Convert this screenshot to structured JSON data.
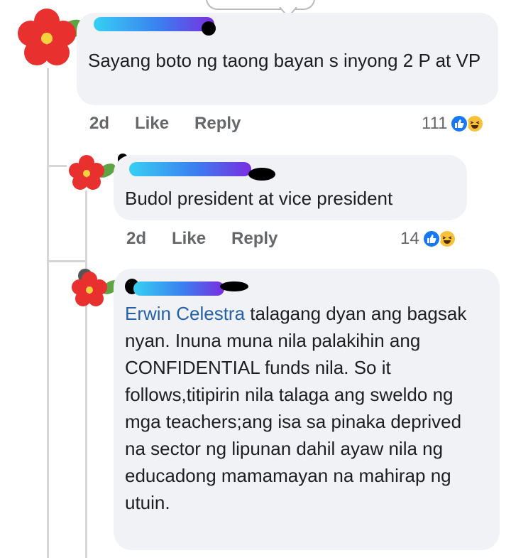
{
  "comments": [
    {
      "text": "Sayang boto ng taong bayan s inyong 2 P at VP",
      "time": "2d",
      "like_label": "Like",
      "reply_label": "Reply",
      "reaction_count": "111"
    },
    {
      "text": "Budol president at vice president",
      "time": "2d",
      "like_label": "Like",
      "reply_label": "Reply",
      "reaction_count": "14"
    },
    {
      "mention": "Erwin Celestra",
      "text": " talagang dyan ang bagsak nyan. Inuna muna nila palakihin ang CONFIDENTIAL funds nila. So it follows,titipirin nila talaga ang sweldo ng mga teachers;ang isa sa pinaka deprived na sector ng lipunan dahil ayaw nila ng educadong mamamayan na mahirap ng utuin."
    }
  ],
  "reaction_icons": [
    "like-icon",
    "haha-icon"
  ],
  "colors": {
    "bubble": "#f0f2f5",
    "mention": "#2660a8",
    "like": "#1877f2",
    "haha": "#f7c23a",
    "meta": "#65676b"
  }
}
